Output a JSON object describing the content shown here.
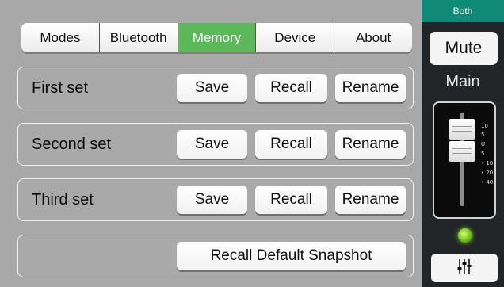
{
  "tabs": [
    {
      "label": "Modes",
      "active": false
    },
    {
      "label": "Bluetooth",
      "active": false
    },
    {
      "label": "Memory",
      "active": true
    },
    {
      "label": "Device",
      "active": false
    },
    {
      "label": "About",
      "active": false
    }
  ],
  "sets": [
    {
      "label": "First set",
      "save": "Save",
      "recall": "Recall",
      "rename": "Rename"
    },
    {
      "label": "Second set",
      "save": "Save",
      "recall": "Recall",
      "rename": "Rename"
    },
    {
      "label": "Third set",
      "save": "Save",
      "recall": "Recall",
      "rename": "Rename"
    }
  ],
  "default_snapshot": {
    "label": "Recall Default Snapshot"
  },
  "side": {
    "header": "Both",
    "mute_label": "Mute",
    "channel_label": "Main",
    "fader_ticks": [
      "10",
      "5",
      "U",
      "5",
      "• 10",
      "• 20",
      "• 40"
    ],
    "led_color": "#7ed321",
    "eq_icon": "mixer-sliders-icon"
  },
  "colors": {
    "active_tab": "#5bb95a",
    "side_header": "#0f8a76"
  }
}
